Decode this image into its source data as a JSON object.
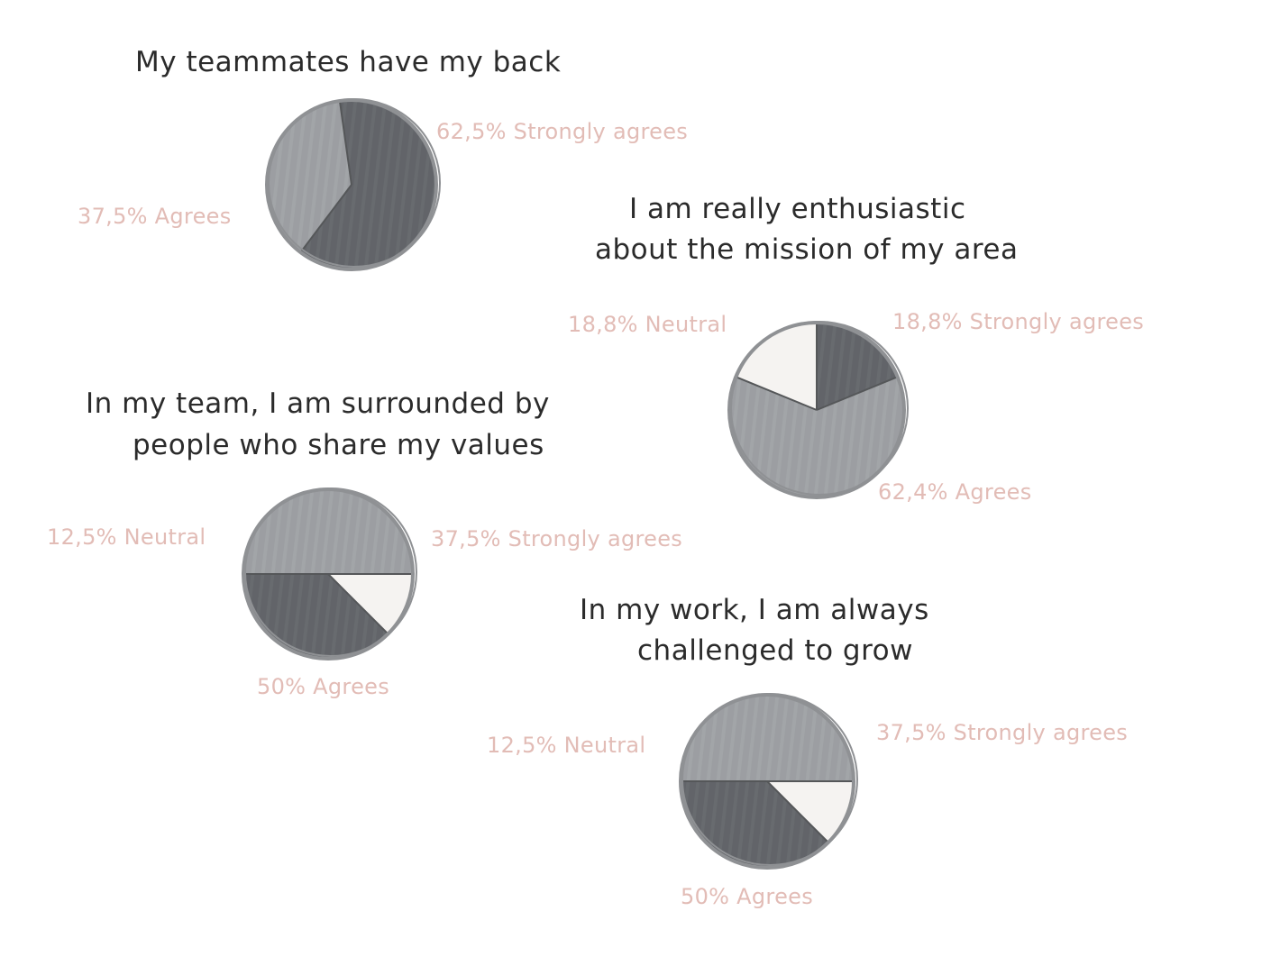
{
  "colors": {
    "strongly_agrees": "#686b6f",
    "agrees": "#a2a5a8",
    "neutral": "#f5f3f1",
    "outline": "#8f9194",
    "title": "#2b2b2b",
    "label": "#e2bcb6"
  },
  "chart_data": [
    {
      "type": "pie",
      "title": "My teammates have my back",
      "slices": [
        {
          "label": "Strongly agrees",
          "value": 62.5,
          "text": "62,5% Strongly agrees",
          "color_key": "strongly_agrees"
        },
        {
          "label": "Agrees",
          "value": 37.5,
          "text": "37,5% Agrees",
          "color_key": "agrees"
        }
      ]
    },
    {
      "type": "pie",
      "title": "I am really enthusiastic about the mission of my area",
      "title_lines": [
        "I am really enthusiastic",
        "about the mission of my area"
      ],
      "slices": [
        {
          "label": "Strongly agrees",
          "value": 18.8,
          "text": "18,8% Strongly agrees",
          "color_key": "strongly_agrees"
        },
        {
          "label": "Agrees",
          "value": 62.4,
          "text": "62,4% Agrees",
          "color_key": "agrees"
        },
        {
          "label": "Neutral",
          "value": 18.8,
          "text": "18,8% Neutral",
          "color_key": "neutral"
        }
      ]
    },
    {
      "type": "pie",
      "title": "In my team, I am surrounded by people who share my values",
      "title_lines": [
        "In my team, I am surrounded by",
        "people who share my values"
      ],
      "slices": [
        {
          "label": "Strongly agrees",
          "value": 37.5,
          "text": "37,5% Strongly agrees",
          "color_key": "strongly_agrees"
        },
        {
          "label": "Agrees",
          "value": 50,
          "text": "50% Agrees",
          "color_key": "agrees"
        },
        {
          "label": "Neutral",
          "value": 12.5,
          "text": "12,5% Neutral",
          "color_key": "neutral"
        }
      ]
    },
    {
      "type": "pie",
      "title": "In my work, I am always challenged to grow",
      "title_lines": [
        "In my work, I am always",
        "challenged to grow"
      ],
      "slices": [
        {
          "label": "Strongly agrees",
          "value": 37.5,
          "text": "37,5% Strongly agrees",
          "color_key": "strongly_agrees"
        },
        {
          "label": "Agrees",
          "value": 50,
          "text": "50% Agrees",
          "color_key": "agrees"
        },
        {
          "label": "Neutral",
          "value": 12.5,
          "text": "12,5% Neutral",
          "color_key": "neutral"
        }
      ]
    }
  ]
}
